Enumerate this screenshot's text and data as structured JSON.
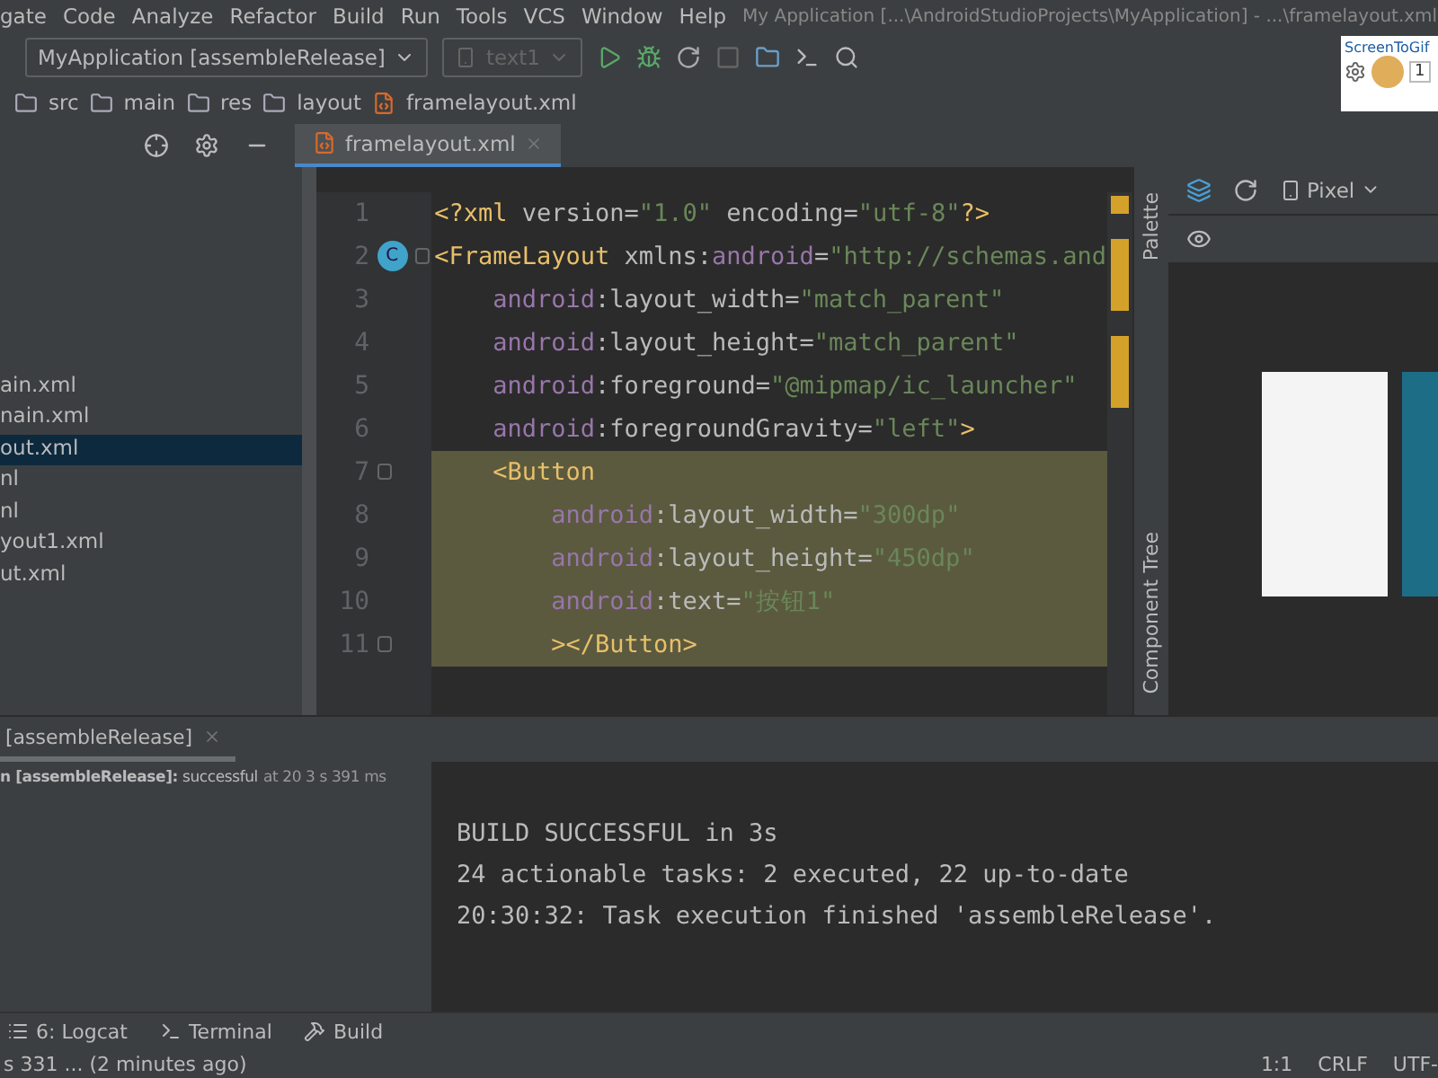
{
  "menu": [
    "gate",
    "Code",
    "Analyze",
    "Refactor",
    "Build",
    "Run",
    "Tools",
    "VCS",
    "Window",
    "Help"
  ],
  "window": {
    "title": "My Application [...\\AndroidStudioProjects\\MyApplication] - ...\\framelayout.xml"
  },
  "toolbar": {
    "run_config": "MyApplication [assembleRelease]",
    "device": "text1",
    "device_disabled": true
  },
  "overlay": {
    "title": "ScreenToGif",
    "field": "1"
  },
  "breadcrumb": [
    "src",
    "main",
    "res",
    "layout",
    "framelayout.xml"
  ],
  "editor_tabs": [
    {
      "label": "framelayout.xml",
      "selected": true
    }
  ],
  "project_files": [
    {
      "label": "ain.xml",
      "selected": false
    },
    {
      "label": "nain.xml",
      "selected": false
    },
    {
      "label": "out.xml",
      "selected": true
    },
    {
      "label": "nl",
      "selected": false
    },
    {
      "label": "nl",
      "selected": false
    },
    {
      "label": "yout1.xml",
      "selected": false
    },
    {
      "label": "ut.xml",
      "selected": false
    }
  ],
  "code_lines": [
    {
      "number": "1",
      "highlighted": false,
      "fold": false,
      "tokens": [
        {
          "kind": "tag",
          "text": "<?xml "
        },
        {
          "kind": "attr",
          "text": "version="
        },
        {
          "kind": "value",
          "text": "\"1.0\" "
        },
        {
          "kind": "attr",
          "text": "encoding="
        },
        {
          "kind": "value",
          "text": "\"utf-8\""
        },
        {
          "kind": "tag",
          "text": "?>"
        }
      ]
    },
    {
      "number": "2",
      "highlighted": false,
      "fold": true,
      "badge": "C",
      "tokens": [
        {
          "kind": "tag",
          "text": "<FrameLayout "
        },
        {
          "kind": "attr",
          "text": "xmlns:"
        },
        {
          "kind": "ns",
          "text": "android"
        },
        {
          "kind": "attr",
          "text": "="
        },
        {
          "kind": "value",
          "text": "\"http://schemas.and"
        }
      ]
    },
    {
      "number": "3",
      "highlighted": false,
      "fold": false,
      "tokens": [
        {
          "kind": "ns",
          "text": "    android"
        },
        {
          "kind": "attr",
          "text": ":layout_width="
        },
        {
          "kind": "value",
          "text": "\"match_parent\""
        }
      ]
    },
    {
      "number": "4",
      "highlighted": false,
      "fold": false,
      "tokens": [
        {
          "kind": "ns",
          "text": "    android"
        },
        {
          "kind": "attr",
          "text": ":layout_height="
        },
        {
          "kind": "value",
          "text": "\"match_parent\""
        }
      ]
    },
    {
      "number": "5",
      "highlighted": false,
      "fold": false,
      "tokens": [
        {
          "kind": "ns",
          "text": "    android"
        },
        {
          "kind": "attr",
          "text": ":foreground="
        },
        {
          "kind": "value",
          "text": "\"@mipmap/ic_launcher\""
        }
      ]
    },
    {
      "number": "6",
      "highlighted": false,
      "fold": false,
      "tokens": [
        {
          "kind": "ns",
          "text": "    android"
        },
        {
          "kind": "attr",
          "text": ":foregroundGravity="
        },
        {
          "kind": "value",
          "text": "\"left\""
        },
        {
          "kind": "tag",
          "text": ">"
        }
      ]
    },
    {
      "number": "7",
      "highlighted": true,
      "fold": true,
      "tokens": [
        {
          "kind": "tag",
          "text": "    <Button"
        }
      ]
    },
    {
      "number": "8",
      "highlighted": true,
      "fold": false,
      "tokens": [
        {
          "kind": "ns",
          "text": "        android"
        },
        {
          "kind": "attr",
          "text": ":layout_width="
        },
        {
          "kind": "value",
          "text": "\"300dp\""
        }
      ]
    },
    {
      "number": "9",
      "highlighted": true,
      "fold": false,
      "tokens": [
        {
          "kind": "ns",
          "text": "        android"
        },
        {
          "kind": "attr",
          "text": ":layout_height="
        },
        {
          "kind": "value",
          "text": "\"450dp\""
        }
      ]
    },
    {
      "number": "10",
      "highlighted": true,
      "fold": false,
      "tokens": [
        {
          "kind": "ns",
          "text": "        android"
        },
        {
          "kind": "attr",
          "text": ":text="
        },
        {
          "kind": "value",
          "text": "\"按钮1\""
        }
      ]
    },
    {
      "number": "11",
      "highlighted": true,
      "fold": true,
      "tokens": [
        {
          "kind": "tag",
          "text": "        ></Button>"
        }
      ]
    }
  ],
  "design": {
    "device": "Pixel",
    "side_tabs": [
      "Palette",
      "Component Tree"
    ]
  },
  "build_tab": {
    "label": "[assembleRelease]",
    "selected": true
  },
  "build_tree": {
    "summary": "**n [assembleRelease]:** successful",
    "timing": "at 20 3 s 391 ms"
  },
  "console": [
    "BUILD SUCCESSFUL in 3s",
    "24 actionable tasks: 2 executed, 22 up-to-date",
    "20:30:32: Task execution finished 'assembleRelease'."
  ],
  "tool_tabs": [
    {
      "label": "6: Logcat"
    },
    {
      "label": "Terminal"
    },
    {
      "label": "Build"
    }
  ],
  "status_bar": {
    "message": "s 331 ... (2 minutes ago)",
    "position": "1:1",
    "line_ending": "CRLF",
    "encoding": "UTF-"
  }
}
